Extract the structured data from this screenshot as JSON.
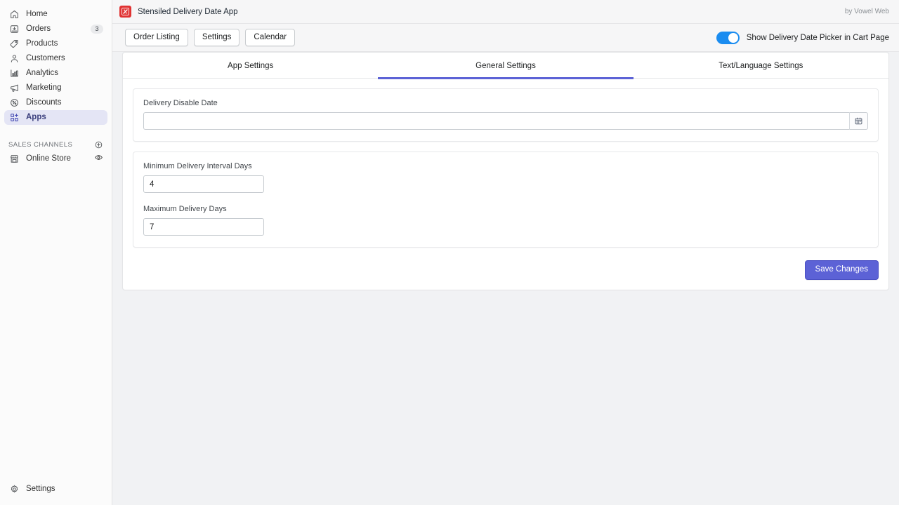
{
  "sidebar": {
    "items": [
      {
        "label": "Home",
        "icon": "home-icon",
        "badge": null,
        "active": false
      },
      {
        "label": "Orders",
        "icon": "orders-icon",
        "badge": "3",
        "active": false
      },
      {
        "label": "Products",
        "icon": "products-tag-icon",
        "badge": null,
        "active": false
      },
      {
        "label": "Customers",
        "icon": "customers-person-icon",
        "badge": null,
        "active": false
      },
      {
        "label": "Analytics",
        "icon": "analytics-bar-chart-icon",
        "badge": null,
        "active": false
      },
      {
        "label": "Marketing",
        "icon": "marketing-megaphone-icon",
        "badge": null,
        "active": false
      },
      {
        "label": "Discounts",
        "icon": "discounts-percent-icon",
        "badge": null,
        "active": false
      },
      {
        "label": "Apps",
        "icon": "apps-grid-plus-icon",
        "badge": null,
        "active": true
      }
    ],
    "sales_channels": {
      "title": "SALES CHANNELS",
      "add_icon": "plus-circle-icon",
      "items": [
        {
          "label": "Online Store",
          "icon": "online-store-icon",
          "action_icon": "eye-icon"
        }
      ]
    },
    "footer": {
      "label": "Settings",
      "icon": "gear-icon"
    }
  },
  "topbar": {
    "app_title": "Stensiled Delivery Date App",
    "logo_icon": "app-logo-icon",
    "credit": "by Vowel Web"
  },
  "actionbar": {
    "buttons": [
      {
        "label": "Order Listing"
      },
      {
        "label": "Settings"
      },
      {
        "label": "Calendar"
      }
    ],
    "toggle": {
      "label": "Show Delivery Date Picker in Cart Page",
      "on": true,
      "color": "#1a8cf0"
    }
  },
  "tabs": [
    {
      "label": "App Settings",
      "active": false
    },
    {
      "label": "General Settings",
      "active": true
    },
    {
      "label": "Text/Language Settings",
      "active": false
    }
  ],
  "form": {
    "delivery_disable_date": {
      "label": "Delivery Disable Date",
      "value": "",
      "placeholder": "",
      "addon_icon": "calendar-icon"
    },
    "minimum_delivery_interval_days": {
      "label": "Minimum Delivery Interval Days",
      "value": "4",
      "placeholder": ""
    },
    "maximum_delivery_days": {
      "label": "Maximum Delivery Days",
      "value": "7",
      "placeholder": ""
    }
  },
  "footer": {
    "save_label": "Save Changes"
  },
  "colors": {
    "accent": "#5c62d6",
    "toggle_on": "#1a8cf0",
    "logo": "#e03232",
    "page_bg": "#f1f2f4"
  }
}
